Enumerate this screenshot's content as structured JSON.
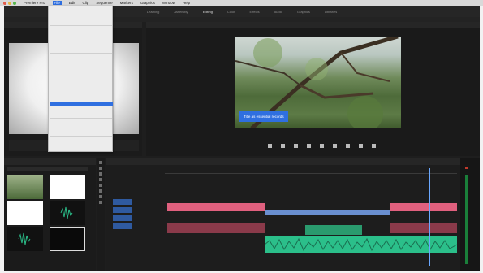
{
  "menubar": {
    "items": [
      "Premiere Pro",
      "File",
      "Edit",
      "Clip",
      "Sequence",
      "Markers",
      "Graphics",
      "Window",
      "Help"
    ],
    "active": "File"
  },
  "workspace_tabs": [
    "Learning",
    "Assembly",
    "Editing",
    "Color",
    "Effects",
    "Audio",
    "Graphics",
    "Libraries"
  ],
  "program_monitor": {
    "caption_text": "Title as essential records"
  },
  "colors": {
    "accent": "#2f6fe0",
    "clip_pink": "#e0607e",
    "clip_audio_green": "#2bbf8a",
    "clip_video_blue": "#6a8fd0",
    "panel_bg": "#1e1e1e"
  },
  "icons": [
    "red-close-dot",
    "yellow-minimize-dot",
    "green-zoom-dot",
    "play-icon",
    "step-back-icon",
    "step-forward-icon",
    "marker-icon",
    "insert-icon"
  ]
}
